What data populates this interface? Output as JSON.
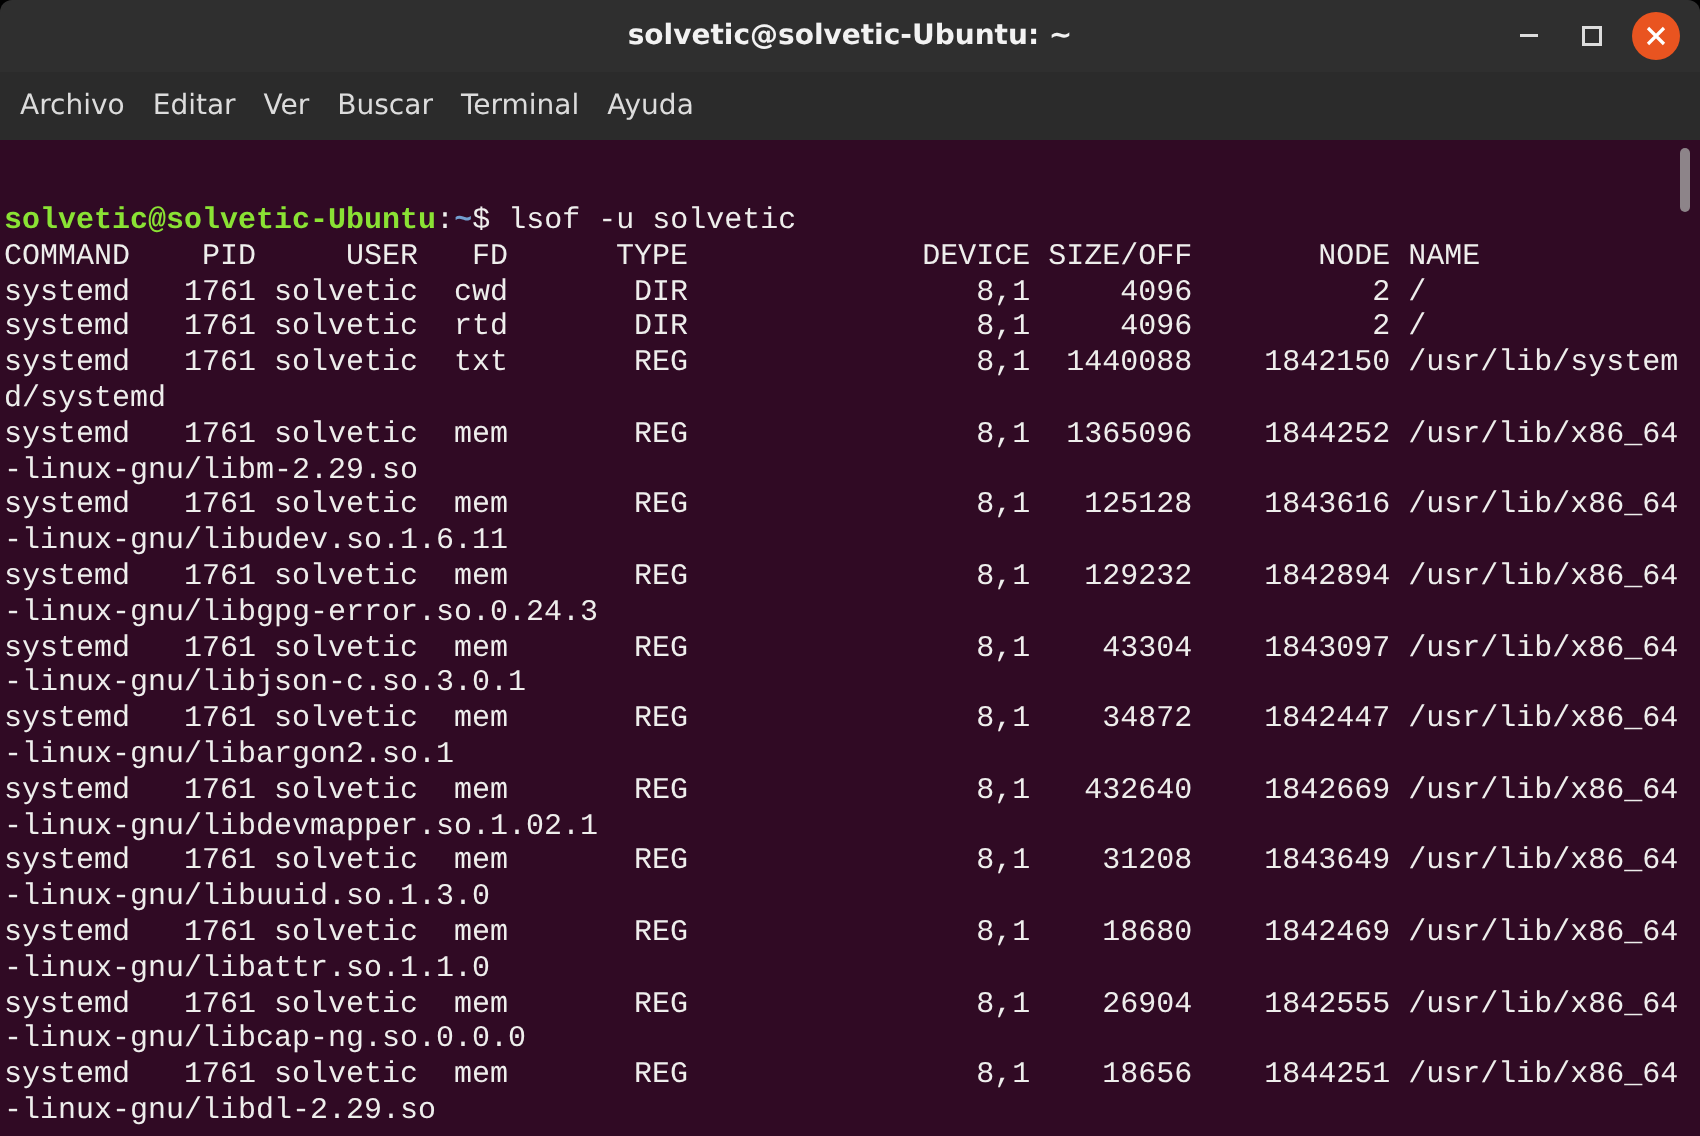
{
  "window": {
    "title": "solvetic@solvetic-Ubuntu: ~"
  },
  "menu": [
    "Archivo",
    "Editar",
    "Ver",
    "Buscar",
    "Terminal",
    "Ayuda"
  ],
  "terminal": {
    "prompt": {
      "user_host": "solvetic@solvetic-Ubuntu",
      "separator": ":",
      "path": "~",
      "command": "$ lsof -u solvetic"
    },
    "lines": [
      "COMMAND    PID     USER   FD      TYPE             DEVICE SIZE/OFF       NODE NAME",
      "systemd   1761 solvetic  cwd       DIR                8,1     4096          2 /",
      "systemd   1761 solvetic  rtd       DIR                8,1     4096          2 /",
      "systemd   1761 solvetic  txt       REG                8,1  1440088    1842150 /usr/lib/system",
      "d/systemd",
      "systemd   1761 solvetic  mem       REG                8,1  1365096    1844252 /usr/lib/x86_64",
      "-linux-gnu/libm-2.29.so",
      "systemd   1761 solvetic  mem       REG                8,1   125128    1843616 /usr/lib/x86_64",
      "-linux-gnu/libudev.so.1.6.11",
      "systemd   1761 solvetic  mem       REG                8,1   129232    1842894 /usr/lib/x86_64",
      "-linux-gnu/libgpg-error.so.0.24.3",
      "systemd   1761 solvetic  mem       REG                8,1    43304    1843097 /usr/lib/x86_64",
      "-linux-gnu/libjson-c.so.3.0.1",
      "systemd   1761 solvetic  mem       REG                8,1    34872    1842447 /usr/lib/x86_64",
      "-linux-gnu/libargon2.so.1",
      "systemd   1761 solvetic  mem       REG                8,1   432640    1842669 /usr/lib/x86_64",
      "-linux-gnu/libdevmapper.so.1.02.1",
      "systemd   1761 solvetic  mem       REG                8,1    31208    1843649 /usr/lib/x86_64",
      "-linux-gnu/libuuid.so.1.3.0",
      "systemd   1761 solvetic  mem       REG                8,1    18680    1842469 /usr/lib/x86_64",
      "-linux-gnu/libattr.so.1.1.0",
      "systemd   1761 solvetic  mem       REG                8,1    26904    1842555 /usr/lib/x86_64",
      "-linux-gnu/libcap-ng.so.0.0.0",
      "systemd   1761 solvetic  mem       REG                8,1    18656    1844251 /usr/lib/x86_64",
      "-linux-gnu/libdl-2.29.so"
    ]
  }
}
